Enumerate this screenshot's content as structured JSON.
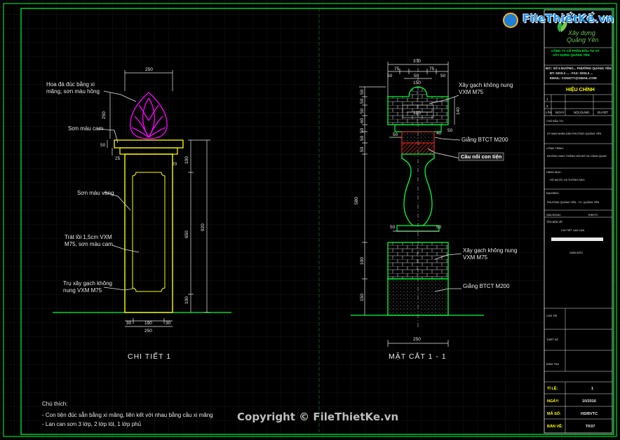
{
  "brand": {
    "logo_text": "FileThiếtKế.vn",
    "company_line1": "Xây dựng",
    "company_line2": "Quảng Yên",
    "copyright": "Copyright © FileThietKe.vn"
  },
  "detail1": {
    "title": "CHI TIẾT 1",
    "labels": {
      "finial": [
        "Hoa đá đúc bằng xi",
        "măng, sơn màu hồng"
      ],
      "cap": "Sơn màu cam",
      "yellow": "Sơn màu vàng",
      "plaster": [
        "Trát lồi 1,5cm VXM",
        "M75, sơn màu cam"
      ],
      "body": [
        "Trụ xây gạch không",
        "nung VXM M75"
      ]
    },
    "dims": {
      "top_width": "250",
      "finial_h": "250",
      "cap_h": "50",
      "cap_off": "25",
      "total_h": "920",
      "panel_h": "650",
      "top_panel_h": "100",
      "base_h": "100",
      "bot_side_l": "30",
      "bot_mid": "190",
      "bot_side_r": "30",
      "bot_total": "250",
      "small_20": "20"
    }
  },
  "section": {
    "title": "MẶT CẮT 1 - 1",
    "labels": {
      "brick_top": [
        "Xây gạch không nung",
        "VXM M75"
      ],
      "beam_top": "Giằng BTCT M200",
      "baluster": "Cầu nối con tiện",
      "brick_bot": [
        "Xây gạch không nung",
        "VXM M75"
      ],
      "beam_bot": "Giằng BTCT M200"
    },
    "dims": {
      "top_total": "370",
      "top_75a": "75",
      "top_75b": "75",
      "top_50a": "50",
      "top_50b": "50",
      "top_50c": "50",
      "inner_150": "150",
      "inner_120": "120",
      "side_50": "50",
      "side_40": "40",
      "cap_140": "140",
      "beam_50": "50",
      "beam_50b": "50",
      "left_50a": "50",
      "left_50b": "50",
      "left_50c": "50",
      "left_50d": "50",
      "left_50e": "50",
      "left_580": "580",
      "left_100": "100",
      "left_150": "150",
      "left_60": "60",
      "left_50f": "50",
      "bottom_total": "250"
    }
  },
  "notes": {
    "heading": "Chú thích:",
    "items": [
      "- Con tiện đúc sẵn bằng xi măng, liên kết với nhau bằng cầu xi măng",
      "- Lan can sơn 3 lớp, 2 lớp lót, 1 lớp phủ"
    ]
  },
  "title_block": {
    "revision_heading": "HIỆU CHỈNH",
    "rev_rows": [
      "1",
      "2"
    ],
    "rev_headers": [
      "LẦN",
      "NGÀY",
      "NỘI DUNG",
      "DUYỆT"
    ],
    "rows": [
      "CÔNG TY CỔ PHẦN ĐẦU TƯ VÀ",
      "XÂY DỰNG QUẢNG YÊN",
      "Đ/C: SỐ 5 ĐƯỜNG... PHƯỜNG QUẢNG YÊN",
      "ĐT: 0203.3 ... - FAX: 0203.3 ...",
      "EMAIL: CONGTY@GMAIL.COM"
    ],
    "fields": [
      "CHỦ ĐẦU TƯ:",
      "ỦY BAN NHÂN DÂN PHƯỜNG QUẢNG YÊN",
      "CÔNG TRÌNH:",
      "ĐƯỜNG GIAO THÔNG NỘI BỘ VÀ CẢNH QUAN",
      "HẠNG MỤC:",
      "HỒ NƯỚC VÀ TƯỜNG RÀO",
      "ĐỊA ĐIỂM:",
      "PHƯỜNG QUẢNG YÊN - TX. QUẢNG YÊN",
      "GIAI ĐOẠN:",
      "TKBVTC",
      "TÊN BẢN VẼ:",
      "CHI TIẾT LAN CAN",
      "GIÁM ĐỐC"
    ],
    "sign_rows": [
      "CHỦ TRÌ",
      "THIẾT KẾ",
      "KIỂM TRA"
    ],
    "meta": [
      {
        "k": "TỈ LỆ:",
        "v": "1"
      },
      {
        "k": "NGÀY:",
        "v": "10/2016"
      },
      {
        "k": "MÃ SỐ:",
        "v": "HS/BVTC"
      },
      {
        "k": "BẢN VẼ:",
        "v": "TK07"
      }
    ]
  },
  "colors": {
    "frame": "#00ff3a",
    "yellow": "#ffff00",
    "magenta": "#ff00ff",
    "white": "#e8e8e8",
    "red": "#ff1a1a",
    "grid": "#141414"
  }
}
